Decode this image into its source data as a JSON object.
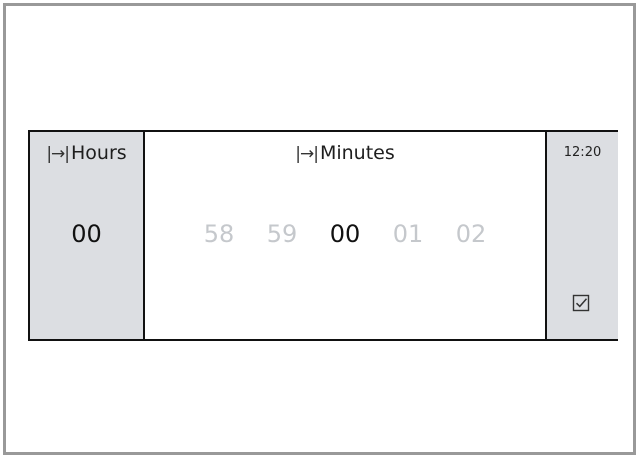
{
  "hours": {
    "header_icon": "skip-to-end-icon",
    "header_icon_glyph": "|→|",
    "label": "Hours",
    "value": "00"
  },
  "minutes": {
    "header_icon": "skip-to-end-icon",
    "header_icon_glyph": "|→|",
    "label": "Minutes",
    "options": [
      "58",
      "59",
      "00",
      "01",
      "02"
    ],
    "selected": "00"
  },
  "status": {
    "time": "12:20",
    "confirm_icon": "checkbox-checked-icon"
  }
}
